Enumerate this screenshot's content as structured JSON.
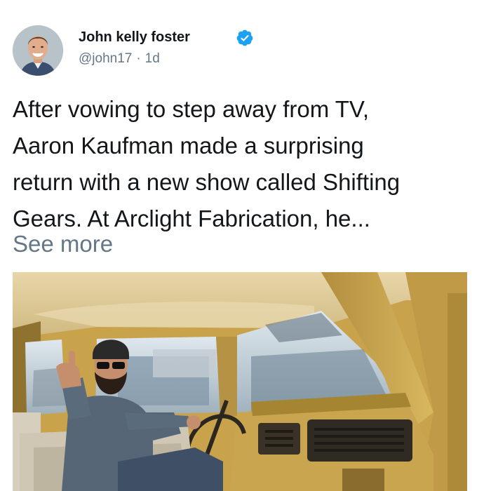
{
  "author": {
    "name": "John kelly foster",
    "handle": "@john17",
    "separator": "·",
    "time": "1d",
    "verified": true,
    "verified_color": "#1da1f2"
  },
  "tweet": {
    "lines": [
      "After vowing to step away from TV,",
      "Aaron Kaufman made a surprising",
      "return with a new show called Shifting",
      "Gears. At Arclight Fabrication, he..."
    ],
    "see_more": "See more"
  },
  "icons": {
    "verified": "verified-badge-icon"
  },
  "colors": {
    "text_primary": "#14171a",
    "text_secondary": "#657786",
    "accent": "#1da1f2"
  }
}
